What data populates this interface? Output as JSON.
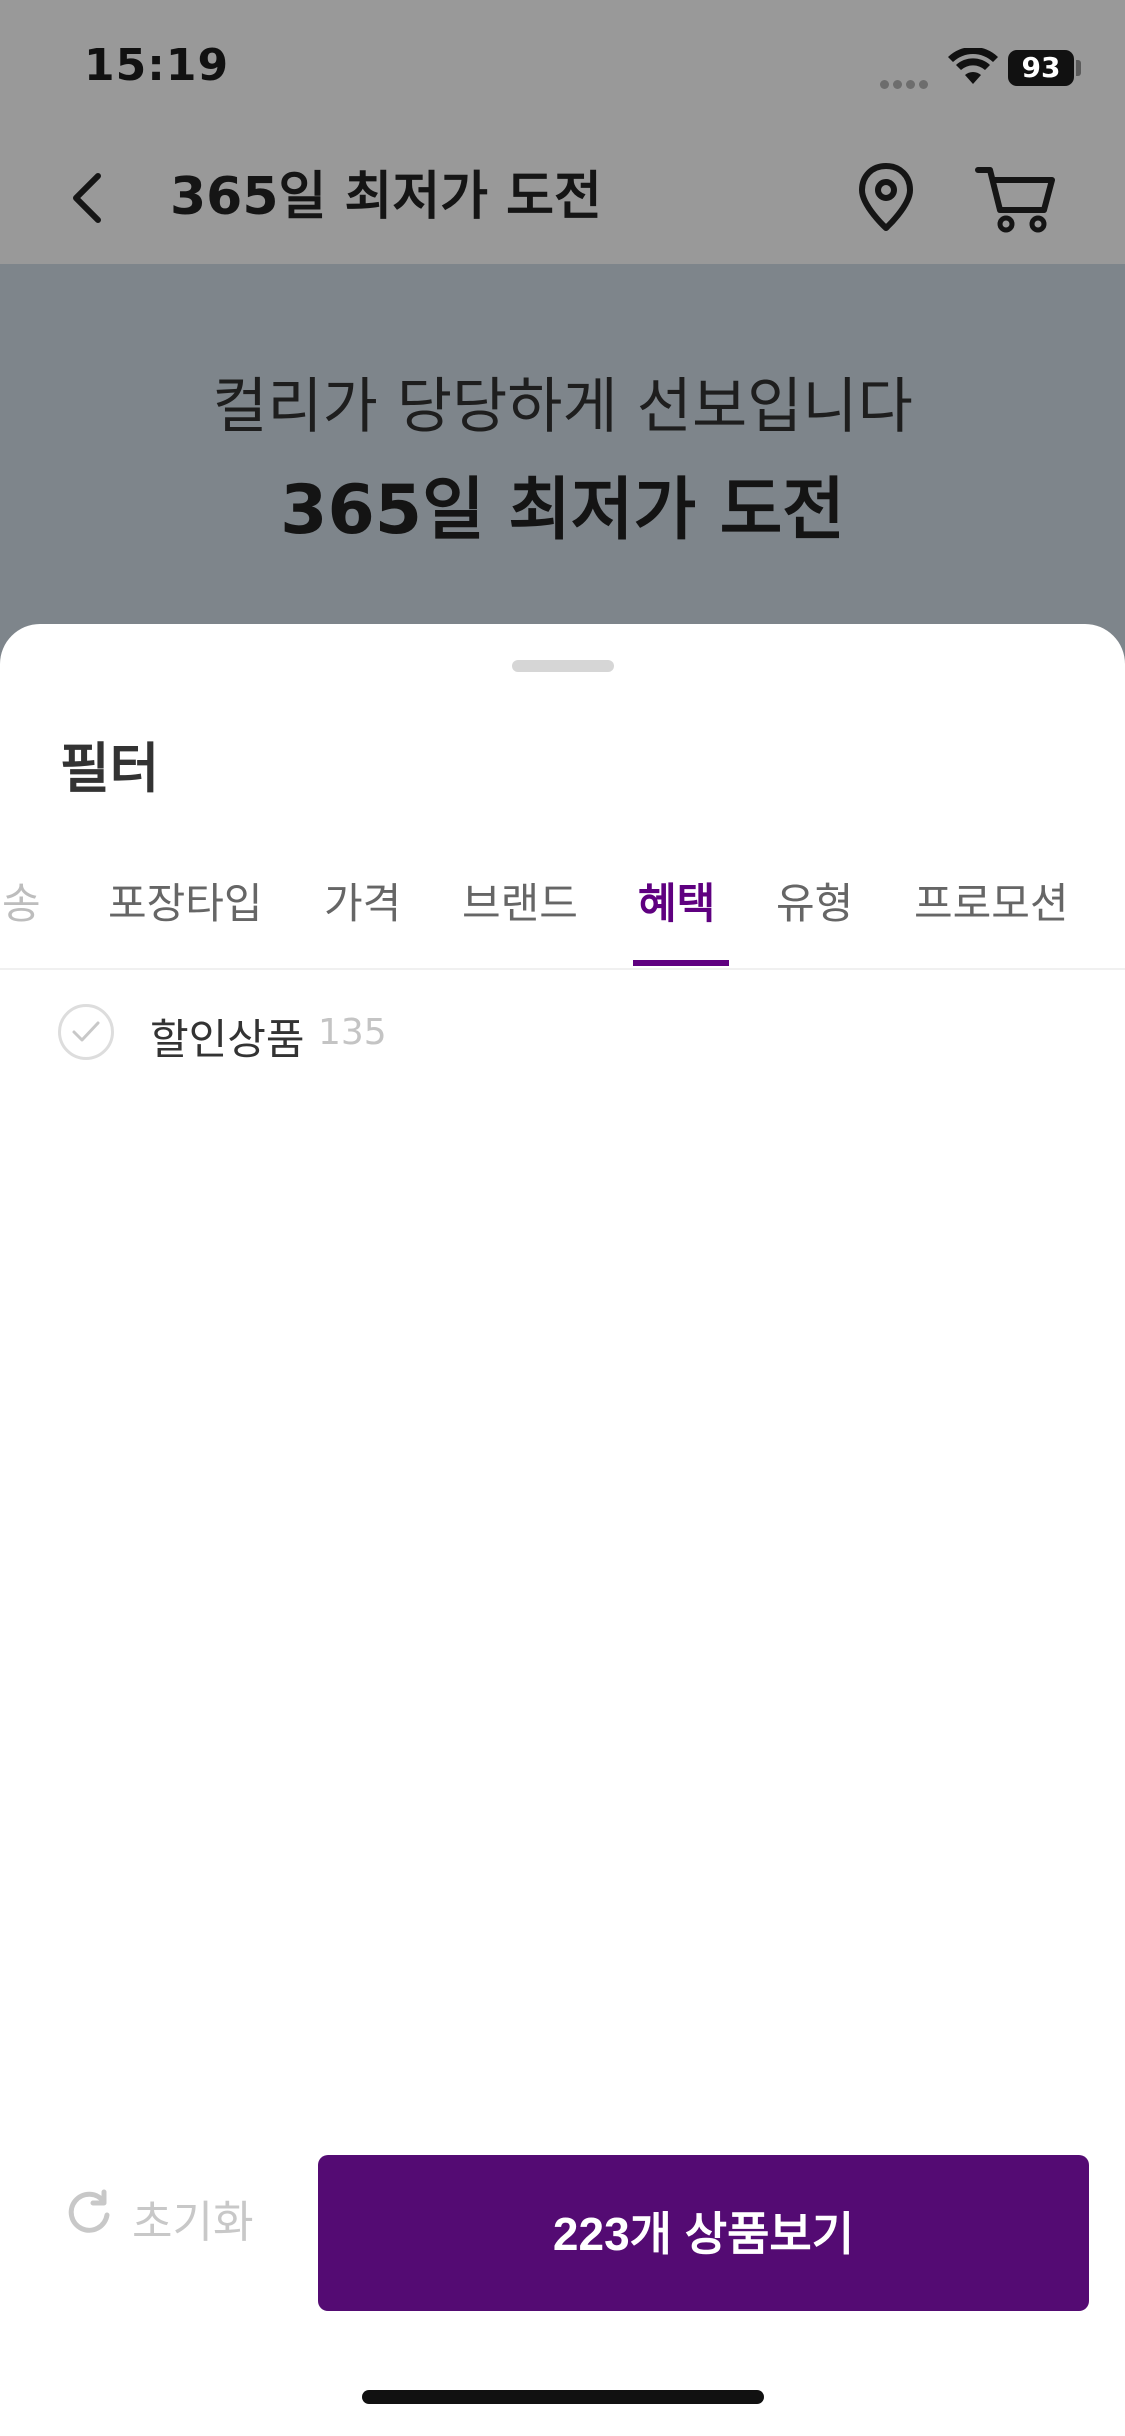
{
  "status_bar": {
    "time": "15:19",
    "battery": "93"
  },
  "header": {
    "title": "365일 최저가 도전",
    "back_icon": "chevron-left-icon",
    "location_icon": "location-pin-icon",
    "cart_icon": "cart-icon"
  },
  "banner": {
    "subtitle": "컬리가 당당하게 선보입니다",
    "title": "365일 최저가 도전"
  },
  "sheet": {
    "title": "필터",
    "tabs": [
      {
        "label": "송"
      },
      {
        "label": "포장타입"
      },
      {
        "label": "가격"
      },
      {
        "label": "브랜드"
      },
      {
        "label": "혜택"
      },
      {
        "label": "유형"
      },
      {
        "label": "프로모션"
      }
    ],
    "active_tab": "혜택",
    "options": [
      {
        "label": "할인상품",
        "count": "135"
      }
    ]
  },
  "footer": {
    "reset_label": "초기화",
    "view_label": "223개 상품보기"
  },
  "colors": {
    "accent": "#5f0080",
    "button": "#540b73",
    "overlay": "#999999"
  }
}
